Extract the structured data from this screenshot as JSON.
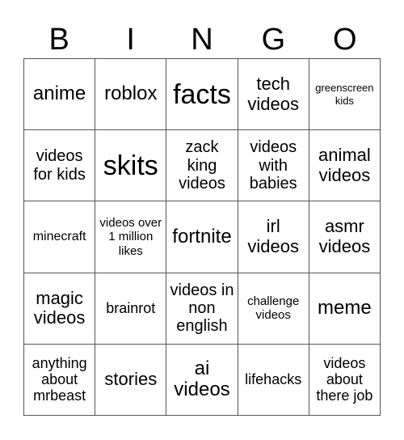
{
  "header": {
    "letters": [
      "B",
      "I",
      "N",
      "G",
      "O"
    ]
  },
  "card": {
    "rows": [
      [
        "anime",
        "roblox",
        "facts",
        "tech videos",
        "greenscreen kids"
      ],
      [
        "videos for kids",
        "skits",
        "zack king videos",
        "videos with babies",
        "animal videos"
      ],
      [
        "minecraft",
        "videos over 1 million likes",
        "fortnite",
        "irl videos",
        "asmr videos"
      ],
      [
        "magic videos",
        "brainrot",
        "videos in non english",
        "challenge videos",
        "meme"
      ],
      [
        "anything about mrbeast",
        "stories",
        "ai videos",
        "lifehacks",
        "videos about there job"
      ]
    ]
  }
}
